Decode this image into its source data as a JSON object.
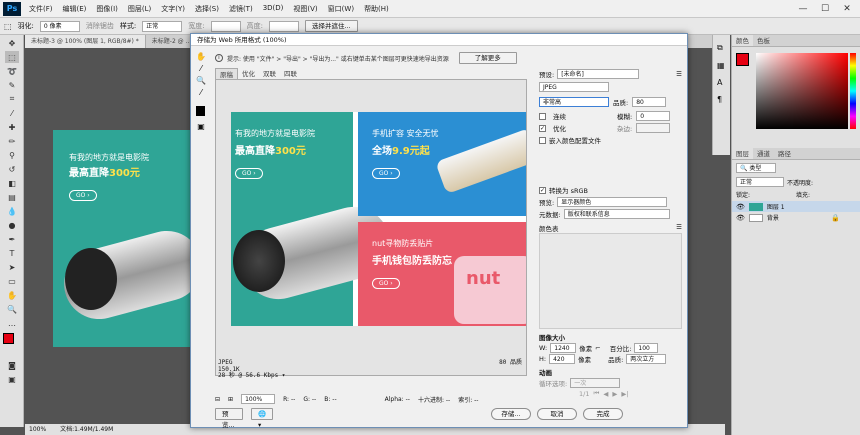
{
  "app": {
    "logo": "Ps",
    "menus": [
      "文件(F)",
      "编辑(E)",
      "图像(I)",
      "图层(L)",
      "文字(Y)",
      "选择(S)",
      "滤镜(T)",
      "3D(D)",
      "视图(V)",
      "窗口(W)",
      "帮助(H)"
    ]
  },
  "options": {
    "feather_label": "羽化:",
    "feather_value": "0 像素",
    "antialias": "消除锯齿",
    "style_label": "样式:",
    "style_value": "正常",
    "width_label": "宽度:",
    "height_label": "高度:",
    "select_mask": "选择并遮住..."
  },
  "tabs": [
    "未标题-3 @ 100% (图层 1, RGB/8#) *",
    "未标题-2 @ ..."
  ],
  "status": {
    "zoom": "100%",
    "doc": "文档:1.49M/1.49M"
  },
  "panels": {
    "color_tabs": [
      "颜色",
      "色板"
    ],
    "layer_tabs": [
      "图层",
      "通道",
      "路径"
    ],
    "kind": "类型",
    "blend": "正常",
    "opacity_label": "不透明度:",
    "lock_label": "锁定:",
    "fill_label": "填充:",
    "layer1": "图层 1",
    "background": "背景"
  },
  "dialog": {
    "title": "存储为 Web 所用格式 (100%)",
    "hint": "提示: 使用 \"文件\" > \"导出\" > \"导出为...\" 或右键单击某个图层可更快速地导出资源",
    "learn_more": "了解更多",
    "view_tabs": [
      "原稿",
      "优化",
      "双联",
      "四联"
    ],
    "preset_label": "预设:",
    "preset_value": "[未命名]",
    "format": "JPEG",
    "quality_mode": "非常高",
    "quality_label": "品质:",
    "quality_value": "80",
    "progressive": "连续",
    "blur_label": "模糊:",
    "blur_value": "0",
    "optimized": "优化",
    "matte_label": "杂边:",
    "embed_profile": "嵌入颜色配置文件",
    "convert_srgb": "转换为 sRGB",
    "preview_label": "预览:",
    "preview_value": "显示器颜色",
    "metadata_label": "元数据:",
    "metadata_value": "版权和联系信息",
    "color_table": "颜色表",
    "image_size": "图像大小",
    "w_label": "W:",
    "w_value": "1240",
    "h_label": "H:",
    "h_value": "420",
    "px": "像素",
    "percent_label": "百分比:",
    "percent_value": "100",
    "quality2_label": "品质:",
    "quality2_value": "两次立方",
    "animation": "动画",
    "loop_label": "循环选项:",
    "loop_value": "一次",
    "frame": "1/1",
    "info_format": "JPEG",
    "info_size": "150.1K",
    "info_time": "28 秒 @ 56.6 Kbps",
    "quality_pct": "80 品质",
    "zoom": "100%",
    "r": "R: --",
    "g": "G: --",
    "b": "B: --",
    "alpha": "Alpha: --",
    "hex": "十六进制: --",
    "index": "索引: --",
    "preview_btn": "预览...",
    "save_btn": "存储...",
    "cancel_btn": "取消",
    "done_btn": "完成"
  },
  "art": {
    "left_line1": "有我的地方就是电影院",
    "left_line2": "最高直降",
    "left_price": "300元",
    "go": "GO",
    "tr_line1": "手机扩容 安全无忧",
    "tr_line2": "全场",
    "tr_price": "9.9元起",
    "br_line1": "nut寻物防丢贴片",
    "br_line2": "手机钱包防丢防忘",
    "brand": "nut"
  },
  "colors": {
    "teal": "#2fa596",
    "blue": "#2b8fd3",
    "pink": "#e9596a",
    "yellow": "#ffe14a",
    "fg": "#e60012"
  }
}
